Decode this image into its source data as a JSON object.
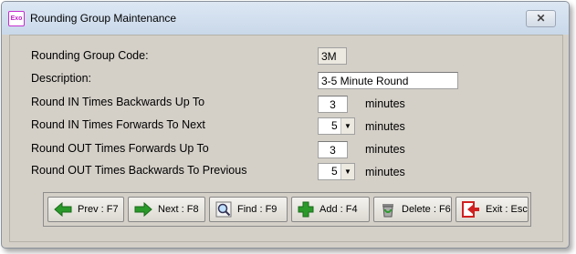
{
  "window": {
    "title": "Rounding Group Maintenance",
    "app_icon_text": "Exo",
    "close_symbol": "✕"
  },
  "form": {
    "code_label": "Rounding Group Code:",
    "code_value": "3M",
    "description_label": "Description:",
    "description_value": "3-5 Minute Round",
    "round_in_backwards_label": "Round IN Times Backwards Up To",
    "round_in_backwards_value": "3",
    "round_in_forwards_label": "Round IN Times Forwards To Next",
    "round_in_forwards_value": "5",
    "round_out_forwards_label": "Round OUT Times Forwards Up To",
    "round_out_forwards_value": "3",
    "round_out_backwards_label": "Round OUT Times Backwards To Previous",
    "round_out_backwards_value": "5",
    "unit_label": "minutes"
  },
  "toolbar": {
    "prev_label": "Prev : F7",
    "next_label": "Next : F8",
    "find_label": "Find : F9",
    "add_label": "Add : F4",
    "delete_label": "Delete : F6",
    "exit_label": "Exit : Esc"
  },
  "icons": {
    "prev": "arrow-left-icon",
    "next": "arrow-right-icon",
    "find": "magnifier-icon",
    "add": "plus-icon",
    "delete": "trash-icon",
    "exit": "exit-icon"
  },
  "colors": {
    "accent_green": "#2a9a2a",
    "exit_red": "#d02020",
    "form_bg": "#d4d0c8"
  }
}
